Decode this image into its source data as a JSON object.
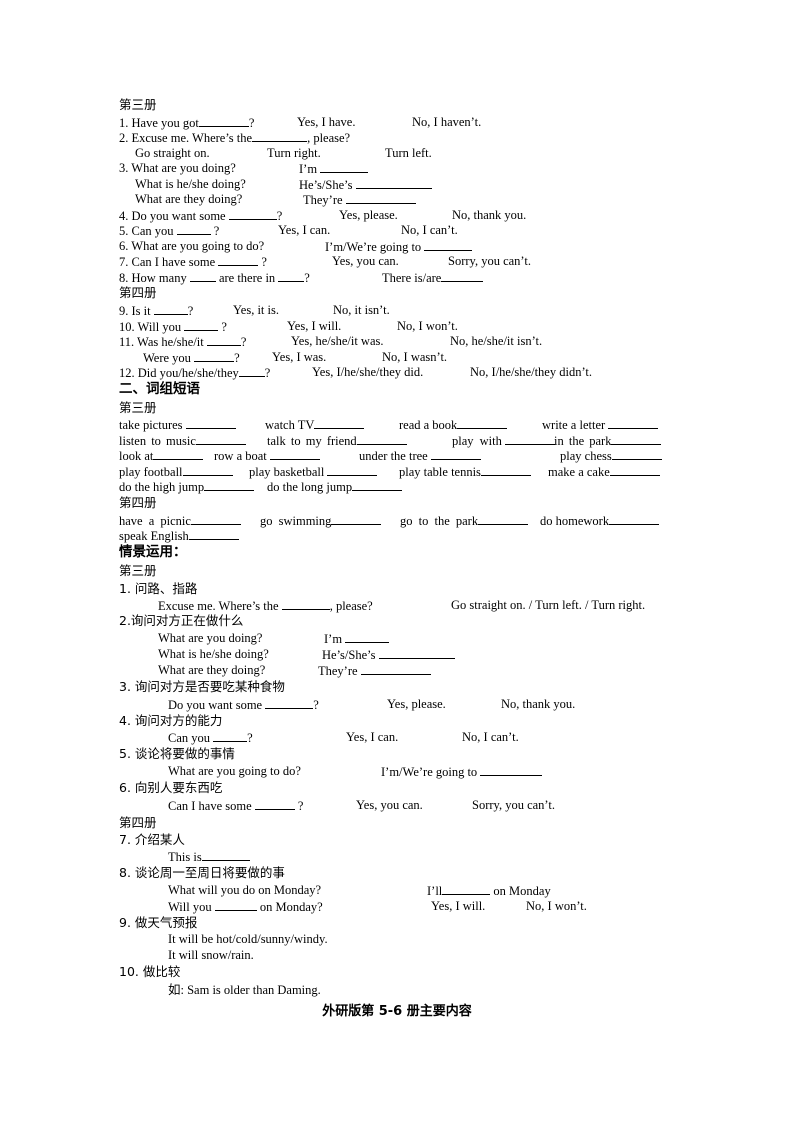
{
  "sections": {
    "book3": "第三册",
    "book4": "第四册",
    "phrases_heading": "二、词组短语",
    "scenario_heading": "情景运用："
  },
  "sentences": {
    "s1": {
      "q": "1. Have you got",
      "q_end": "?",
      "yes": "Yes, I have.",
      "no": "No, I haven’t."
    },
    "s2": {
      "q": "2. Excuse me. Where’s the",
      "q_end": ", please?",
      "a1": "Go straight on.",
      "a2": "Turn right.",
      "a3": "Turn left."
    },
    "s3": {
      "q1": "3. What are you doing?",
      "a1": "I’m",
      "q2": "What is he/she doing?",
      "a2": "He’s/She’s",
      "q3": "What are they doing?",
      "a3": "They’re"
    },
    "s4": {
      "q": "4. Do you want some",
      "q_end": "?",
      "yes": "Yes, please.",
      "no": "No, thank you."
    },
    "s5": {
      "q": "5. Can you",
      "q_end": "?",
      "yes": "Yes, I can.",
      "no": "No, I can’t."
    },
    "s6": {
      "q": "6. What are you going to do?",
      "a": "I’m/We’re going to"
    },
    "s7": {
      "q": "7. Can I have some",
      "q_end": "?",
      "yes": "Yes, you can.",
      "no": "Sorry, you can’t."
    },
    "s8": {
      "q": "8. How many",
      "q_mid": "are there in",
      "q_end": "?",
      "a": "There is/are"
    },
    "s9": {
      "q": "9. Is it",
      "q_end": "?",
      "yes": "Yes, it is.",
      "no": "No, it isn’t."
    },
    "s10": {
      "q": "10. Will you",
      "q_end": "?",
      "yes": "Yes, I will.",
      "no": "No, I won’t."
    },
    "s11": {
      "q": "11. Was he/she/it",
      "q_end": "?",
      "yes": "Yes, he/she/it was.",
      "no": "No, he/she/it isn’t.",
      "q2": "Were you",
      "q2_end": "?",
      "yes2": "Yes, I was.",
      "no2": "No, I wasn’t."
    },
    "s12": {
      "q": "12. Did you/he/she/they",
      "q_end": "?",
      "yes": "Yes, I/he/she/they did.",
      "no": "No, I/he/she/they didn’t."
    }
  },
  "phrases_book3": [
    [
      "take pictures",
      "watch TV",
      "read a book",
      "write a letter"
    ],
    [
      "listen to music",
      "talk to my friend",
      "play with",
      "in the park"
    ],
    [
      "look at",
      "row a boat",
      "under the tree",
      "play chess"
    ],
    [
      "play football",
      "play basketball",
      "play table tennis",
      "make a cake"
    ],
    [
      "do the high jump",
      "do the long jump"
    ]
  ],
  "phrases_book4": [
    [
      "have a picnic",
      "go swimming",
      "go to the park",
      "do homework"
    ],
    [
      "speak English"
    ]
  ],
  "scenarios": {
    "sc1": {
      "title": "1.  问路、指路",
      "q": "Excuse me. Where’s the",
      "q_end": ", please?",
      "a": "Go straight on. / Turn left. / Turn right."
    },
    "sc2": {
      "title": "2.询问对方正在做什么",
      "q1": "What are you doing?",
      "a1": "I’m",
      "q2": "What is he/she doing?",
      "a2": "He’s/She’s",
      "q3": "What are they doing?",
      "a3": "They’re"
    },
    "sc3": {
      "title": "3.  询问对方是否要吃某种食物",
      "q": "Do you want some",
      "q_end": "?",
      "yes": "Yes, please.",
      "no": "No, thank you."
    },
    "sc4": {
      "title": "4.  询问对方的能力",
      "q": "Can you",
      "q_end": "?",
      "yes": "Yes, I can.",
      "no": "No, I can’t."
    },
    "sc5": {
      "title": "5.  谈论将要做的事情",
      "q": "What are you going to do?",
      "a": "I’m/We’re going to"
    },
    "sc6": {
      "title": "6.  向别人要东西吃",
      "q": "Can I have some",
      "q_end": "?",
      "yes": "Yes, you can.",
      "no": "Sorry, you can’t."
    },
    "sc7": {
      "title": "7.  介绍某人",
      "q": "This is"
    },
    "sc8": {
      "title": "8.  谈论周一至周日将要做的事",
      "q1": "What will you do on Monday?",
      "a1": "I’ll",
      "a1_end": "on Monday",
      "q2": "Will you",
      "q2_end": "on Monday?",
      "yes": "Yes, I will.",
      "no": "No, I won’t."
    },
    "sc9": {
      "title": "9.  做天气预报",
      "l1": "It will be hot/cold/sunny/windy.",
      "l2": "It will snow/rain."
    },
    "sc10": {
      "title": "10.  做比较",
      "ex": "如: Sam is older than Daming."
    }
  },
  "footer_title": "外研版第 5-6 册主要内容"
}
